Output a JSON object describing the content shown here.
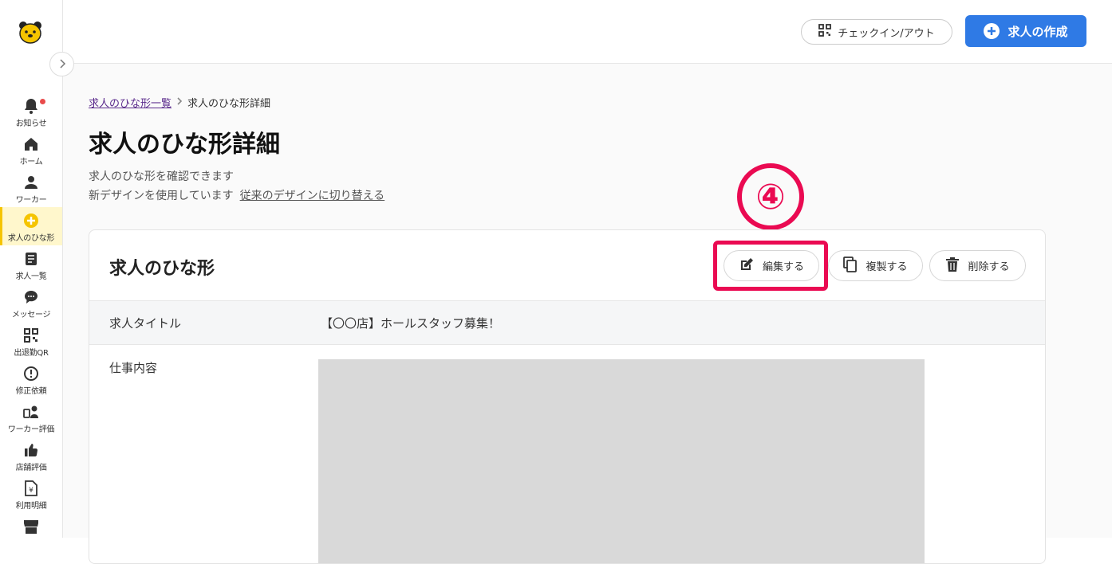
{
  "sidebar": {
    "items": [
      {
        "label": "お知らせ",
        "icon": "bell-icon"
      },
      {
        "label": "ホーム",
        "icon": "home-icon"
      },
      {
        "label": "ワーカー",
        "icon": "person-icon"
      },
      {
        "label": "求人のひな形",
        "icon": "plus-circle-icon"
      },
      {
        "label": "求人一覧",
        "icon": "list-icon"
      },
      {
        "label": "メッセージ",
        "icon": "chat-icon"
      },
      {
        "label": "出退勤QR",
        "icon": "qr-icon"
      },
      {
        "label": "修正依頼",
        "icon": "alert-icon"
      },
      {
        "label": "ワーカー評価",
        "icon": "worker-rating-icon"
      },
      {
        "label": "店舗評価",
        "icon": "thumbs-up-icon"
      },
      {
        "label": "利用明細",
        "icon": "invoice-icon"
      }
    ],
    "active_index": 3
  },
  "header": {
    "checkin_label": "チェックイン/アウト",
    "create_label": "求人の作成"
  },
  "breadcrumb": {
    "parent": "求人のひな形一覧",
    "current": "求人のひな形詳細"
  },
  "page": {
    "title": "求人のひな形詳細",
    "desc_line1": "求人のひな形を確認できます",
    "desc_line2": "新デザインを使用しています",
    "switch_link": "従来のデザインに切り替える"
  },
  "annotation": {
    "label": "④",
    "color": "#ea0a52"
  },
  "card": {
    "title": "求人のひな形",
    "edit_label": "編集する",
    "copy_label": "複製する",
    "delete_label": "削除する",
    "rows": [
      {
        "label": "求人タイトル",
        "value": "【〇〇店】ホールスタッフ募集！"
      },
      {
        "label": "仕事内容"
      }
    ]
  },
  "colors": {
    "accent": "#2f7ae5",
    "brand_yellow": "#f5c400",
    "annotation": "#ea0a52"
  }
}
